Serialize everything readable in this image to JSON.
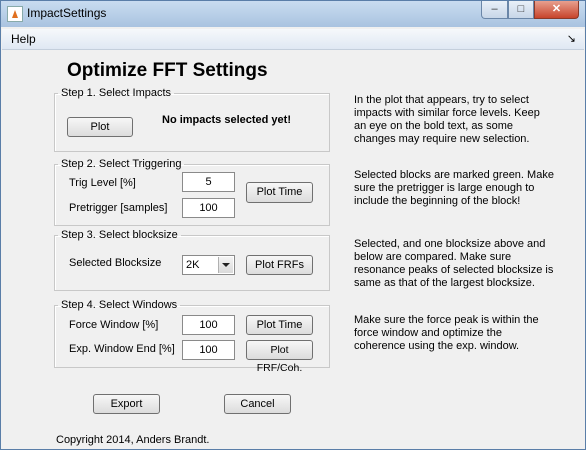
{
  "window": {
    "title": "ImpactSettings",
    "min_glyph": "–",
    "max_glyph": "□",
    "close_glyph": "✕"
  },
  "menu": {
    "help": "Help",
    "dock_glyph": "↘"
  },
  "heading": "Optimize FFT Settings",
  "step1": {
    "legend": "Step 1. Select Impacts",
    "plot_button": "Plot",
    "status": "No impacts selected yet!"
  },
  "step2": {
    "legend": "Step 2. Select Triggering",
    "trig_label": "Trig Level [%]",
    "trig_value": "5",
    "pretrig_label": "Pretrigger [samples]",
    "pretrig_value": "100",
    "plot_button": "Plot Time"
  },
  "step3": {
    "legend": "Step 3. Select blocksize",
    "blocksize_label": "Selected Blocksize",
    "blocksize_value": "2K",
    "plot_button": "Plot FRFs"
  },
  "step4": {
    "legend": "Step 4. Select Windows",
    "force_label": "Force Window [%]",
    "force_value": "100",
    "exp_label": "Exp. Window End [%]",
    "exp_value": "100",
    "plot_time_button": "Plot Time",
    "plot_frf_button": "Plot FRF/Coh."
  },
  "help_text": {
    "step1": "In the plot that appears, try to select impacts with similar force levels. Keep an eye on the bold text, as some changes may require new selection.",
    "step2": "Selected blocks are marked green. Make sure the pretrigger is large enough to include the beginning of the block!",
    "step3": "Selected, and one blocksize above and below are compared. Make sure resonance peaks of selected blocksize is same as that of the largest blocksize.",
    "step4": "Make sure the force peak is within the force window and optimize the coherence using the exp. window."
  },
  "buttons": {
    "export": "Export",
    "cancel": "Cancel"
  },
  "copyright": "Copyright 2014, Anders Brandt."
}
